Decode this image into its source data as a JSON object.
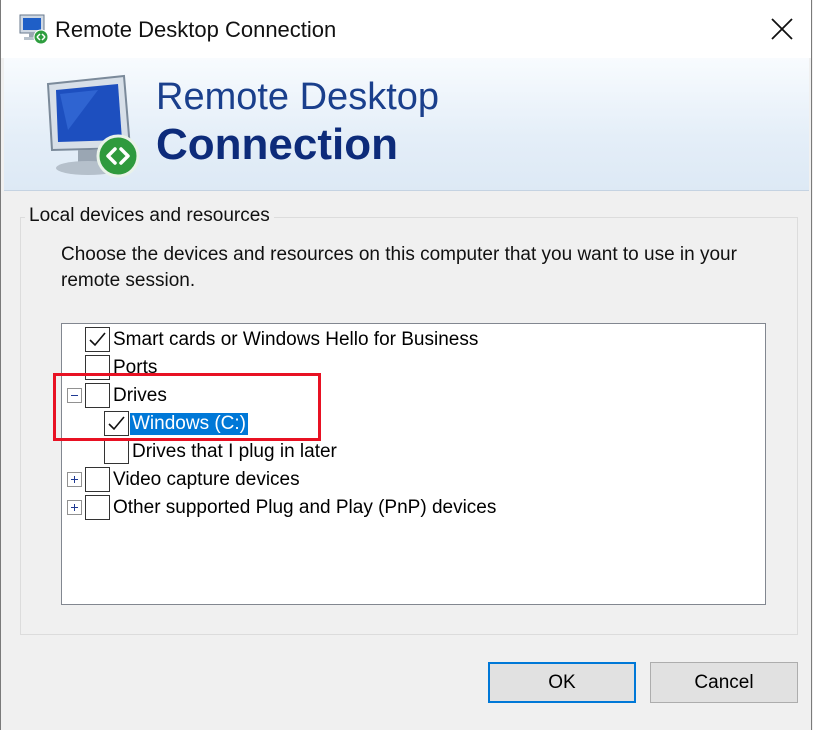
{
  "window": {
    "title": "Remote Desktop Connection"
  },
  "banner": {
    "line1": "Remote Desktop",
    "line2": "Connection"
  },
  "group": {
    "label": "Local devices and resources",
    "instructions": "Choose the devices and resources on this computer that you want to use in your remote session."
  },
  "tree": {
    "smart_cards": {
      "label": "Smart cards or Windows Hello for Business",
      "checked": true
    },
    "ports": {
      "label": "Ports",
      "checked": false
    },
    "drives": {
      "label": "Drives",
      "checked": false,
      "expanded": true
    },
    "windows_c": {
      "label": "Windows (C:)",
      "checked": true,
      "selected": true
    },
    "drives_later": {
      "label": "Drives that I plug in later",
      "checked": false
    },
    "video_capture": {
      "label": "Video capture devices",
      "checked": false,
      "expanded": false
    },
    "pnp": {
      "label": "Other supported Plug and Play (PnP) devices",
      "checked": false,
      "expanded": false
    }
  },
  "buttons": {
    "ok": "OK",
    "cancel": "Cancel"
  },
  "colors": {
    "selection": "#0078d7",
    "annotation": "#e81123",
    "banner_text": "#1a3f8c"
  }
}
